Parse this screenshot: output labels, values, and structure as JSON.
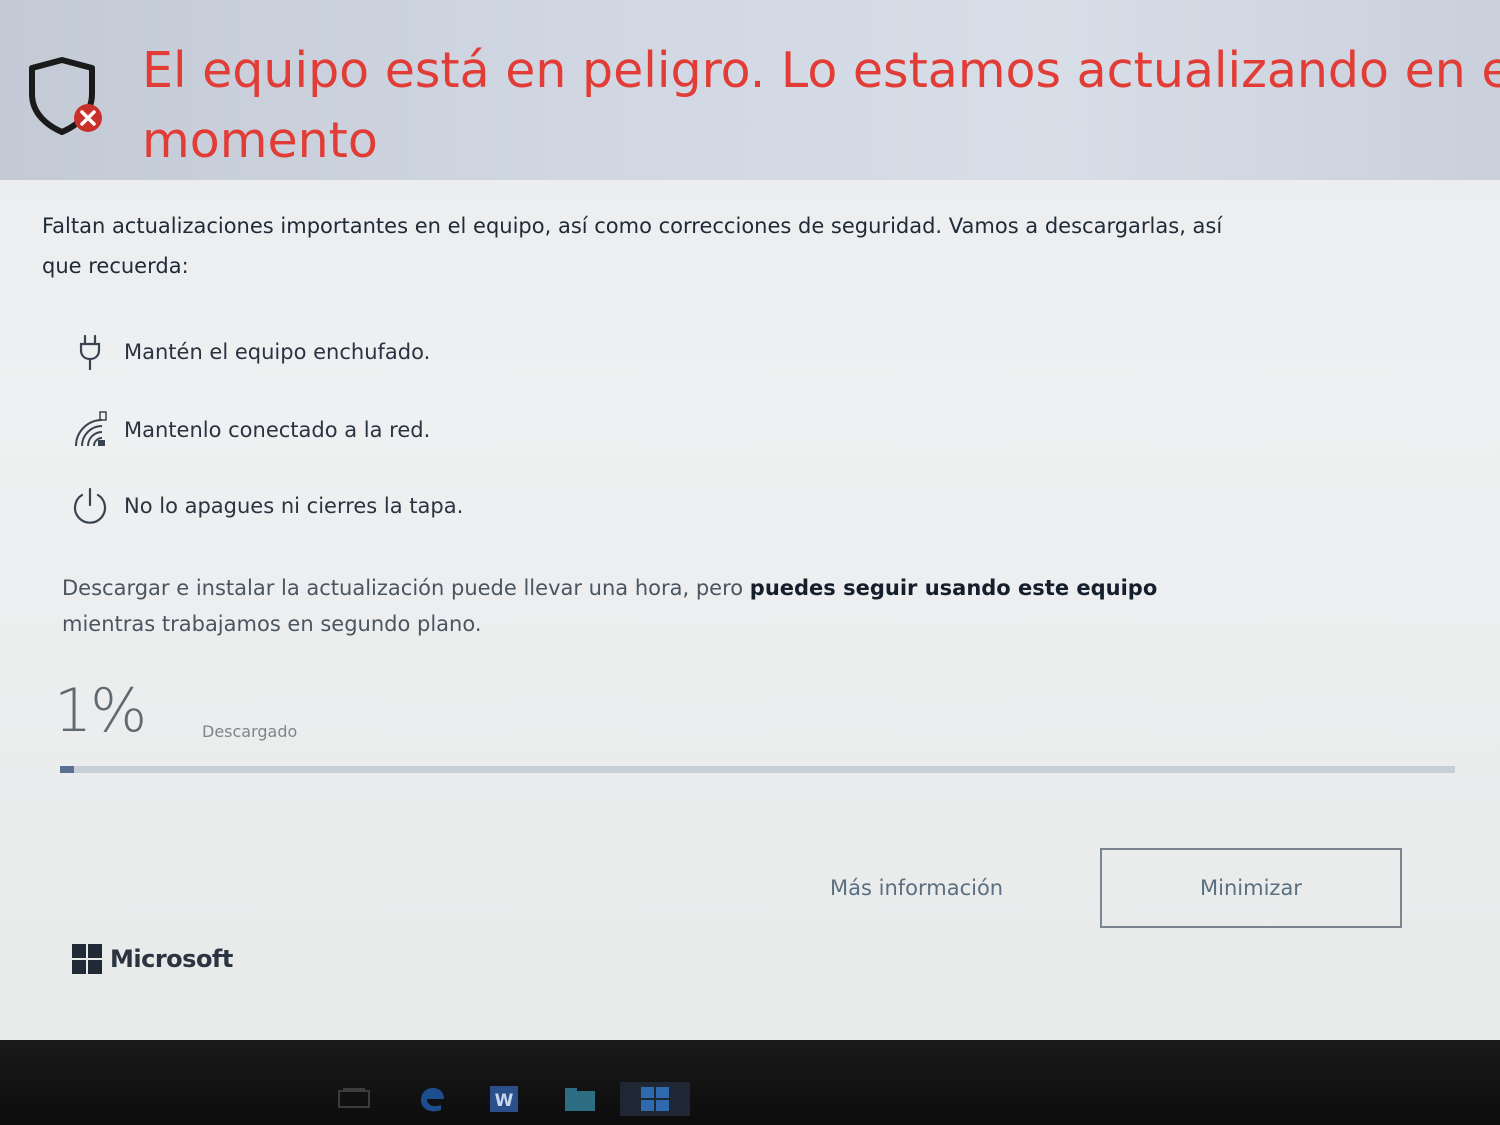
{
  "header": {
    "title_line1": "El equipo está en peligro. Lo estamos actualizando en este",
    "title_line2": "momento",
    "title_color": "#e23c36",
    "icon": "shield-error-icon"
  },
  "intro": {
    "text": "Faltan actualizaciones importantes en el equipo, así como correcciones de seguridad. Vamos a descargarlas, así que recuerda:"
  },
  "tips": [
    {
      "icon": "power-plug-icon",
      "text": "Mantén el equipo enchufado."
    },
    {
      "icon": "wifi-network-icon",
      "text": "Mantenlo conectado a la red."
    },
    {
      "icon": "power-icon",
      "text": "No lo apagues ni cierres la tapa."
    }
  ],
  "note": {
    "before": "Descargar e instalar la actualización puede llevar una hora, pero ",
    "bold": "puedes seguir usando este equipo",
    "after": " mientras trabajamos en segundo plano."
  },
  "progress": {
    "percent_label": "1%",
    "value_fraction": 0.01,
    "status": "Descargado",
    "fill_color": "#5b6f94"
  },
  "actions": {
    "more_info": "Más información",
    "minimize": "Minimizar"
  },
  "brand": {
    "name": "Microsoft"
  },
  "taskbar": {
    "items": [
      "task-view-icon",
      "edge-icon",
      "word-icon",
      "file-explorer-icon",
      "windows-update-icon"
    ]
  }
}
